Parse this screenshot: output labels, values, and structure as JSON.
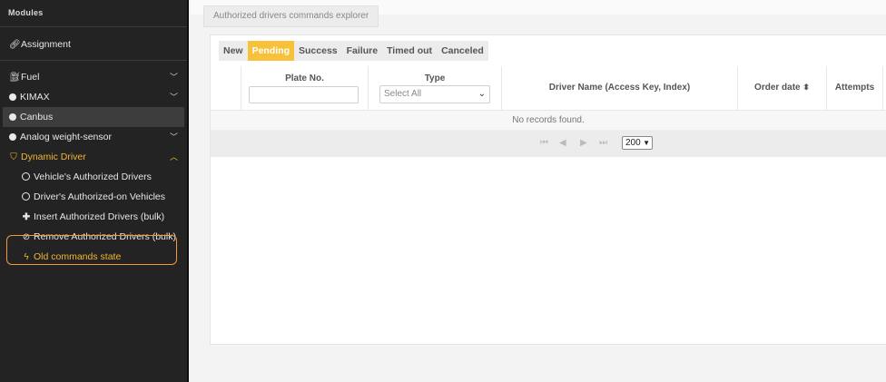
{
  "sidebar": {
    "header": "Modules",
    "items": [
      {
        "label": "Assignment",
        "icon": "link-icon"
      },
      {
        "label": "Fuel",
        "icon": "fuel-icon"
      },
      {
        "label": "KIMAX",
        "icon": "dot-icon"
      },
      {
        "label": "Canbus",
        "icon": "dot-icon"
      },
      {
        "label": "Analog weight-sensor",
        "icon": "dot-icon"
      },
      {
        "label": "Dynamic Driver",
        "icon": "shield-icon"
      }
    ],
    "subitems": [
      {
        "label": "Vehicle's Authorized Drivers",
        "icon": "circle-icon"
      },
      {
        "label": "Driver's Authorized-on Vehicles",
        "icon": "circle-icon"
      },
      {
        "label": "Insert Authorized Drivers (bulk)",
        "icon": "plus-icon"
      },
      {
        "label": "Remove Authorized Drivers (bulk)",
        "icon": "ban-icon"
      },
      {
        "label": "Old commands state",
        "icon": "bolt-icon"
      }
    ]
  },
  "main": {
    "tab_title": "Authorized drivers commands explorer",
    "filters": [
      "New",
      "Pending",
      "Success",
      "Failure",
      "Timed out",
      "Canceled"
    ],
    "selected_filter": "Pending",
    "columns": {
      "plate": "Plate No.",
      "type": "Type",
      "type_select": "Select All",
      "driver": "Driver Name (Access Key, Index)",
      "order_date": "Order date",
      "attempts": "Attempts"
    },
    "empty_message": "No records found.",
    "page_size": "200"
  },
  "colors": {
    "accent": "#f7c23a",
    "highlight": "#f29a3b",
    "sidebar_bg": "#232323"
  }
}
